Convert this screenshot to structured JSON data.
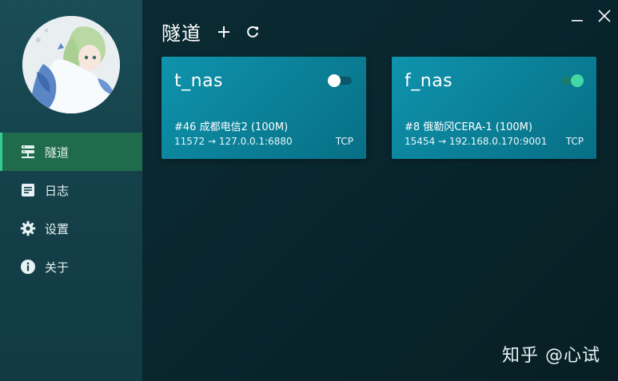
{
  "sidebar": {
    "items": [
      {
        "label": "隧道",
        "icon": "server-icon",
        "active": true
      },
      {
        "label": "日志",
        "icon": "document-icon",
        "active": false
      },
      {
        "label": "设置",
        "icon": "gear-icon",
        "active": false
      },
      {
        "label": "关于",
        "icon": "info-icon",
        "active": false
      }
    ]
  },
  "header": {
    "title": "隧道",
    "add_icon": "plus-icon",
    "refresh_icon": "refresh-icon"
  },
  "window_controls": {
    "minimize_icon": "minimize-icon",
    "close_icon": "close-icon"
  },
  "tunnels": [
    {
      "name": "t_nas",
      "enabled": false,
      "server": "#46 成都电信2 (100M)",
      "mapping": "11572 → 127.0.0.1:6880",
      "protocol": "TCP"
    },
    {
      "name": "f_nas",
      "enabled": true,
      "server": "#8 俄勒冈CERA-1 (100M)",
      "mapping": "15454 → 192.168.0.170:9001",
      "protocol": "TCP"
    }
  ],
  "watermark": "知乎 @心试",
  "colors": {
    "active_nav": "#1f6b4b",
    "active_accent": "#2fd08e",
    "card": "#0a8aa3",
    "toggle_on": "#41d8a6"
  }
}
